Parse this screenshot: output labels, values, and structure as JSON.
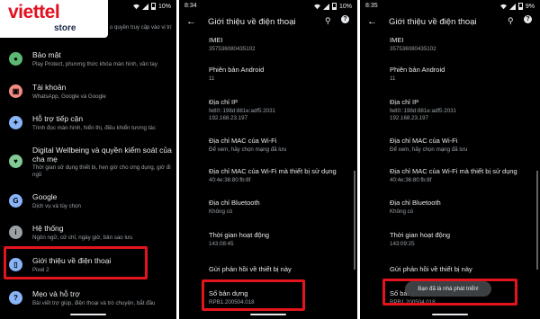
{
  "panel1": {
    "status": {
      "battery": "10%"
    },
    "logo": {
      "brand": "viettel",
      "store": "store"
    },
    "top_sub": "o quyền truy cập vào vị trí",
    "items": [
      {
        "title": "Bảo mật",
        "sub": "Play Protect, phương thức khóa màn hình, vân tay",
        "color": "#5bb974",
        "icon": "lock-icon",
        "glyph": "●"
      },
      {
        "title": "Tài khoản",
        "sub": "WhatsApp, Google và Google",
        "color": "#f28b82",
        "icon": "account-icon",
        "glyph": "▣"
      },
      {
        "title": "Hỗ trợ tiếp cận",
        "sub": "Trình đọc màn hình, hiển thị, điều khiển tương tác",
        "color": "#8ab4f8",
        "icon": "accessibility-icon",
        "glyph": "✦"
      },
      {
        "title": "Digital Wellbeing và quyền kiểm soát của cha mẹ",
        "sub": "Thời gian sử dụng thiết bị, hẹn giờ cho ứng dụng, giờ đi ngủ",
        "color": "#81c995",
        "icon": "wellbeing-icon",
        "glyph": "♥"
      },
      {
        "title": "Google",
        "sub": "Dịch vụ và tùy chọn",
        "color": "#8ab4f8",
        "icon": "google-icon",
        "glyph": "G"
      },
      {
        "title": "Hệ thống",
        "sub": "Ngôn ngữ, cử chỉ, ngày giờ, bản sao lưu",
        "color": "#9aa0a6",
        "icon": "system-icon",
        "glyph": "i"
      },
      {
        "title": "Giới thiệu về điện thoại",
        "sub": "Pixel 2",
        "color": "#8ab4f8",
        "icon": "phone-icon",
        "glyph": "▯"
      },
      {
        "title": "Mẹo và hỗ trợ",
        "sub": "Bài viết trợ giúp, điện thoại và trò chuyện, bắt đầu",
        "color": "#8ab4f8",
        "icon": "help-icon",
        "glyph": "?"
      }
    ]
  },
  "panel2": {
    "status": {
      "time": "8:34",
      "battery": "10%"
    },
    "title": "Giới thiệu về điện thoại",
    "rows": [
      {
        "label": "IMEI",
        "value": "357536080435102"
      },
      {
        "label": "Phiên bản Android",
        "value": "11"
      },
      {
        "label": "Địa chỉ IP",
        "value": "fe80::198d:881e:adf5:2031",
        "value2": "192.168.23.197"
      },
      {
        "label": "Địa chỉ MAC của Wi-Fi",
        "value": "Để xem, hãy chọn mạng đã lưu"
      },
      {
        "label": "Địa chỉ MAC của Wi-Fi mà thiết bị sử dụng",
        "value": "40:4e:36:80:fb:8f"
      },
      {
        "label": "Địa chỉ Bluetooth",
        "value": "Không có"
      },
      {
        "label": "Thời gian hoạt động",
        "value": "143:08:45"
      },
      {
        "label": "Gửi phản hồi về thiết bị này",
        "value": ""
      },
      {
        "label": "Số bản dựng",
        "value": "RPB1.200504.018"
      }
    ]
  },
  "panel3": {
    "status": {
      "time": "8:35",
      "battery": "9%"
    },
    "title": "Giới thiệu về điện thoại",
    "rows": [
      {
        "label": "IMEI",
        "value": "357536080435102"
      },
      {
        "label": "Phiên bản Android",
        "value": "11"
      },
      {
        "label": "Địa chỉ IP",
        "value": "fe80::198d:881e:adf5:2031",
        "value2": "192.168.23.197"
      },
      {
        "label": "Địa chỉ MAC của Wi-Fi",
        "value": "Để xem, hãy chọn mạng đã lưu"
      },
      {
        "label": "Địa chỉ MAC của Wi-Fi mà thiết bị sử dụng",
        "value": "40:4e:36:80:fb:8f"
      },
      {
        "label": "Địa chỉ Bluetooth",
        "value": "Không có"
      },
      {
        "label": "Thời gian hoạt động",
        "value": "143:09:25"
      },
      {
        "label": "Gửi phản hồi về thiết bị này",
        "value": ""
      },
      {
        "label": "Số bản",
        "value": "RPB1.200504.018"
      }
    ],
    "toast": "Bạn đã là nhà phát triển!"
  }
}
